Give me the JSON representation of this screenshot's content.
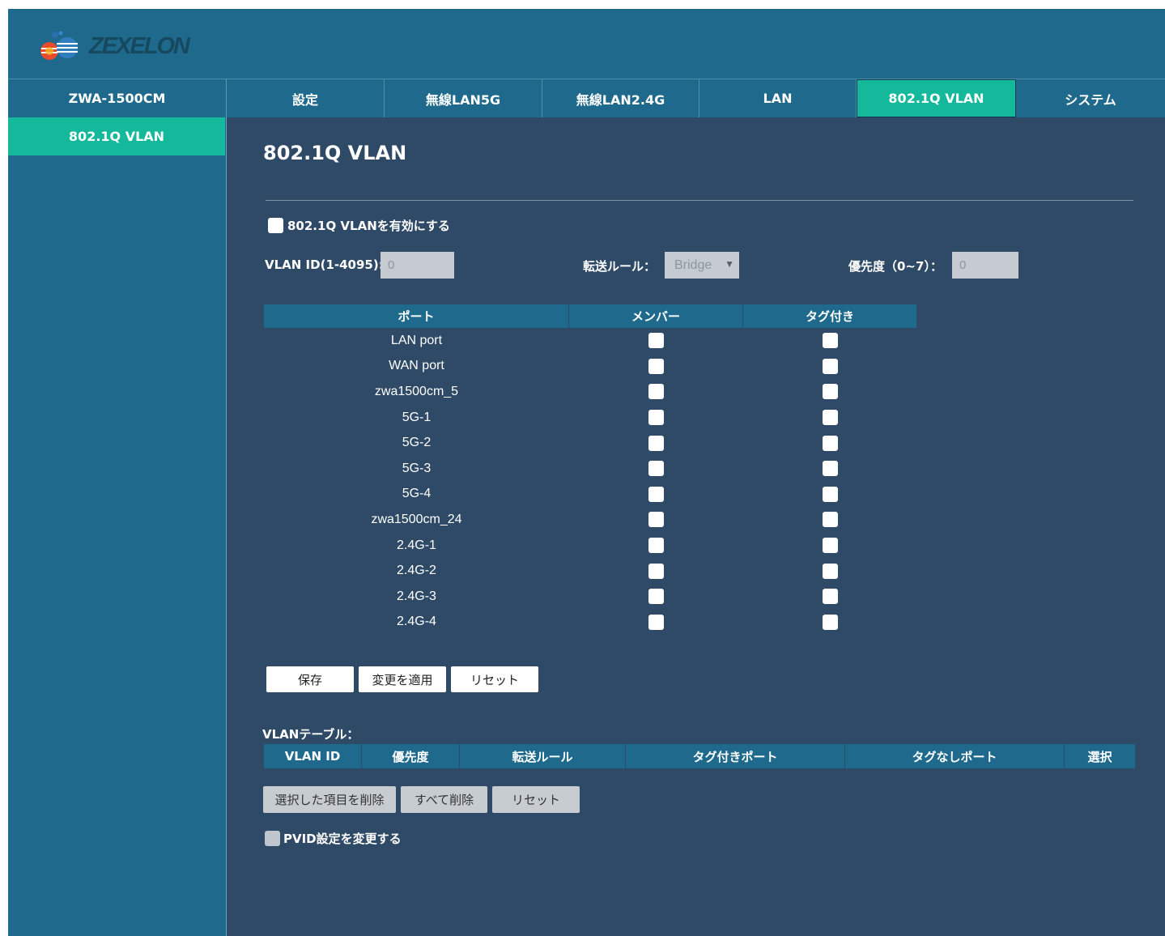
{
  "brand": {
    "logo_text": "ZEXELON"
  },
  "topnav": {
    "device": "ZWA-1500CM",
    "tabs": [
      "設定",
      "無線LAN5G",
      "無線LAN2.4G",
      "LAN",
      "802.1Q VLAN",
      "システム"
    ],
    "active_tab": "802.1Q VLAN"
  },
  "sidebar": {
    "items": [
      {
        "label": "802.1Q VLAN"
      }
    ]
  },
  "page": {
    "title": "802.1Q VLAN",
    "enable_label": "802.1Q VLANを有効にする",
    "vlan_id_label": "VLAN ID(1-4095):",
    "vlan_id_value": "0",
    "forward_label": "転送ルール：",
    "forward_value": "Bridge",
    "priority_label": "優先度（0~7）：",
    "priority_value": "0"
  },
  "port_table": {
    "headers": [
      "ポート",
      "メンバー",
      "タグ付き"
    ],
    "ports": [
      "LAN port",
      "WAN port",
      "zwa1500cm_5",
      "5G-1",
      "5G-2",
      "5G-3",
      "5G-4",
      "zwa1500cm_24",
      "2.4G-1",
      "2.4G-2",
      "2.4G-3",
      "2.4G-4"
    ]
  },
  "buttons": {
    "save": "保存",
    "apply": "変更を適用",
    "reset": "リセット"
  },
  "vlan_table": {
    "label": "VLANテーブル：",
    "headers": [
      "VLAN ID",
      "優先度",
      "転送ルール",
      "タグ付きポート",
      "タグなしポート",
      "選択"
    ]
  },
  "buttons2": {
    "delete_selected": "選択した項目を削除",
    "delete_all": "すべて削除",
    "reset": "リセット"
  },
  "pvid": {
    "label": "PVID設定を変更する"
  },
  "colors": {
    "accent": "#14b89a",
    "nav_bg": "#1f6a8c",
    "content_bg": "#2f4a67"
  }
}
